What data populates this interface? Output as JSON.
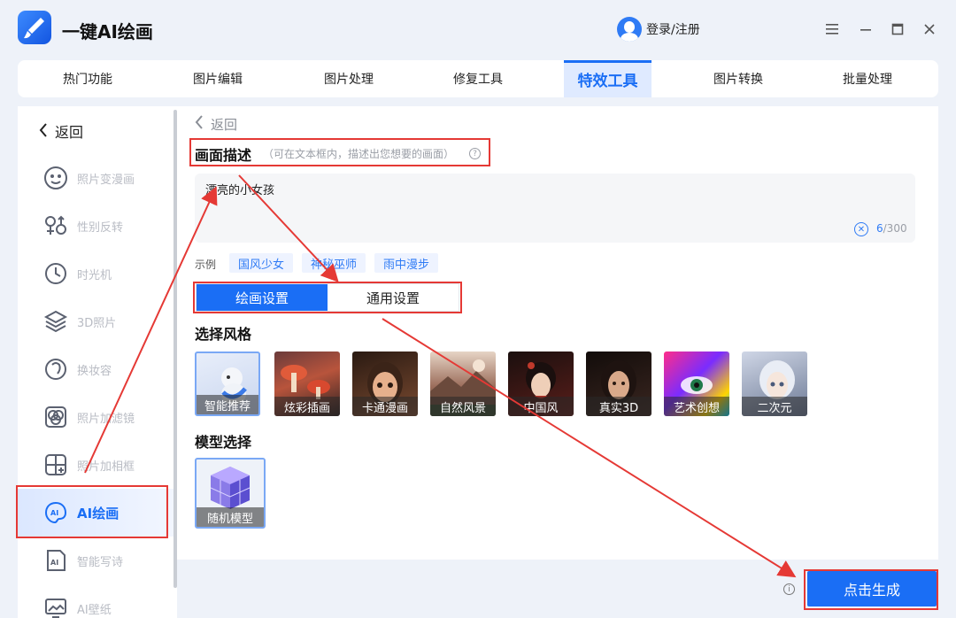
{
  "app": {
    "title": "一键AI绘画",
    "login_label": "登录/注册"
  },
  "tabs": [
    {
      "label": "热门功能",
      "active": false
    },
    {
      "label": "图片编辑",
      "active": false
    },
    {
      "label": "图片处理",
      "active": false
    },
    {
      "label": "修复工具",
      "active": false
    },
    {
      "label": "特效工具",
      "active": true
    },
    {
      "label": "图片转换",
      "active": false
    },
    {
      "label": "批量处理",
      "active": false
    }
  ],
  "sidebar": {
    "back_label": "返回",
    "items": [
      {
        "label": "照片变漫画",
        "icon": "face-cartoon-icon"
      },
      {
        "label": "性别反转",
        "icon": "gender-swap-icon"
      },
      {
        "label": "时光机",
        "icon": "clock-icon"
      },
      {
        "label": "3D照片",
        "icon": "layers-icon"
      },
      {
        "label": "换妆容",
        "icon": "makeup-icon"
      },
      {
        "label": "照片加滤镜",
        "icon": "filter-icon"
      },
      {
        "label": "照片加相框",
        "icon": "frame-icon"
      },
      {
        "label": "AI绘画",
        "icon": "ai-paint-icon",
        "active": true
      },
      {
        "label": "智能写诗",
        "icon": "ai-poem-icon"
      },
      {
        "label": "AI壁纸",
        "icon": "wallpaper-icon"
      }
    ]
  },
  "main": {
    "back_label": "返回",
    "desc_title": "画面描述",
    "desc_hint": "（可在文本框内，描述出您想要的画面）",
    "prompt_value": "漂亮的小女孩",
    "counter_current": "6",
    "counter_max": "/300",
    "example_label": "示例",
    "examples": [
      "国风少女",
      "神秘巫师",
      "雨中漫步"
    ],
    "segments": [
      {
        "label": "绘画设置",
        "active": true
      },
      {
        "label": "通用设置",
        "active": false
      }
    ],
    "style_title": "选择风格",
    "styles": [
      {
        "label": "智能推荐",
        "selected": true
      },
      {
        "label": "炫彩插画"
      },
      {
        "label": "卡通漫画"
      },
      {
        "label": "自然风景"
      },
      {
        "label": "中国风"
      },
      {
        "label": "真实3D"
      },
      {
        "label": "艺术创想"
      },
      {
        "label": "二次元"
      }
    ],
    "model_title": "模型选择",
    "model_label": "随机模型",
    "generate_label": "点击生成"
  },
  "colors": {
    "accent": "#1a6ef5",
    "annotation": "#e53935"
  }
}
